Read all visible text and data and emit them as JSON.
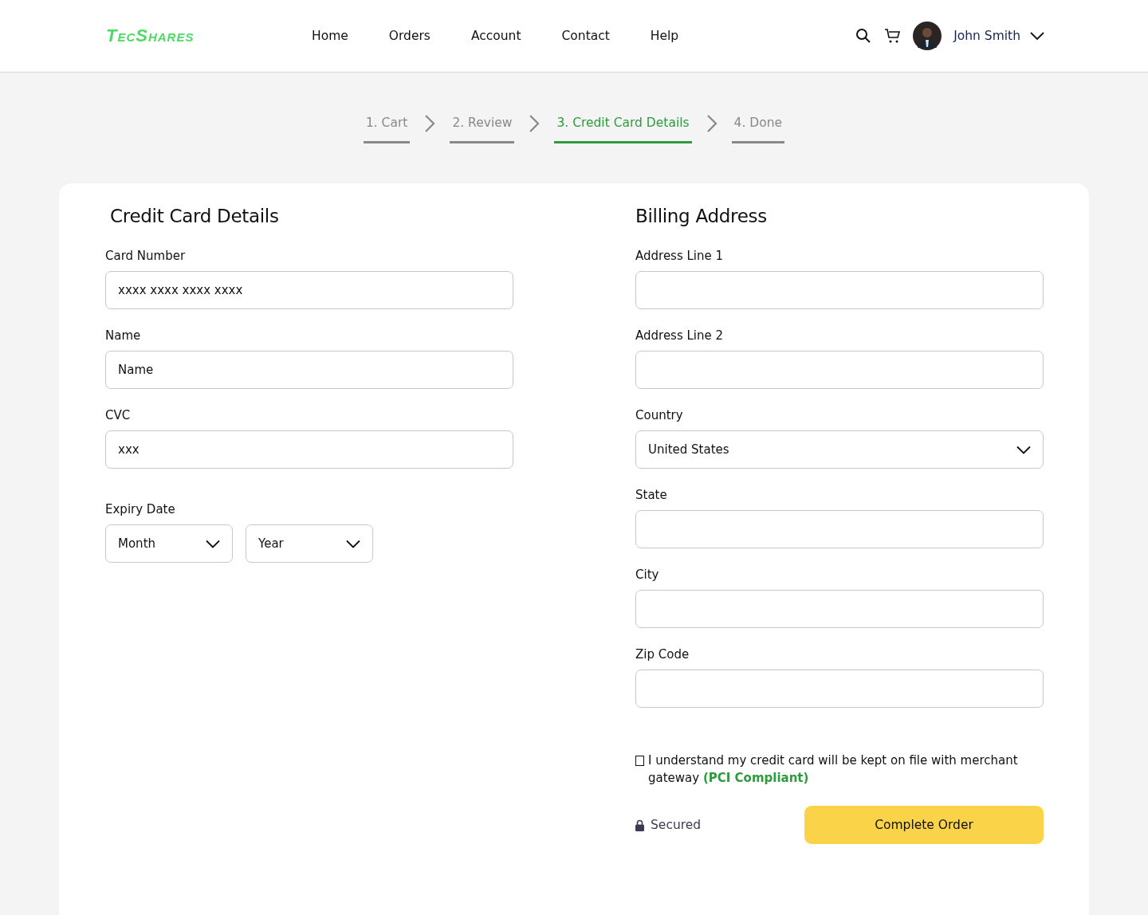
{
  "header": {
    "logo": "TecShares",
    "nav": [
      {
        "label": "Home"
      },
      {
        "label": "Orders"
      },
      {
        "label": "Account"
      },
      {
        "label": "Contact"
      },
      {
        "label": "Help"
      }
    ],
    "user": {
      "name": "John Smith"
    }
  },
  "steps": [
    {
      "label": "1. Cart",
      "selected": false
    },
    {
      "label": "2. Review",
      "selected": false
    },
    {
      "label": "3. Credit Card Details",
      "selected": true
    },
    {
      "label": "4. Done",
      "selected": false
    }
  ],
  "card_details": {
    "title": "Credit Card Details",
    "fields": [
      {
        "label": "Card Number",
        "placeholder": "xxxx xxxx xxxx xxxx"
      },
      {
        "label": "Name",
        "placeholder": "Name"
      },
      {
        "label": "CVC",
        "placeholder": "xxx"
      }
    ],
    "expiry": {
      "label": "Expiry Date",
      "selects": [
        {
          "value": "Month"
        },
        {
          "value": "Year"
        }
      ]
    }
  },
  "billing": {
    "title": "Billing Address",
    "fields": [
      {
        "label": "Address Line 1",
        "kind": "text"
      },
      {
        "label": "Address Line 2",
        "kind": "text"
      },
      {
        "label": "Country",
        "kind": "select",
        "value": "United States"
      },
      {
        "label": "State",
        "kind": "text"
      },
      {
        "label": "City",
        "kind": "text"
      },
      {
        "label": "Zip Code",
        "kind": "text"
      }
    ],
    "consent": {
      "checked": false,
      "text": "I understand my credit card will be kept on file with merchant gateway",
      "link": "(PCI Compliant)"
    },
    "secured": "Secured",
    "submit": "Complete Order"
  }
}
